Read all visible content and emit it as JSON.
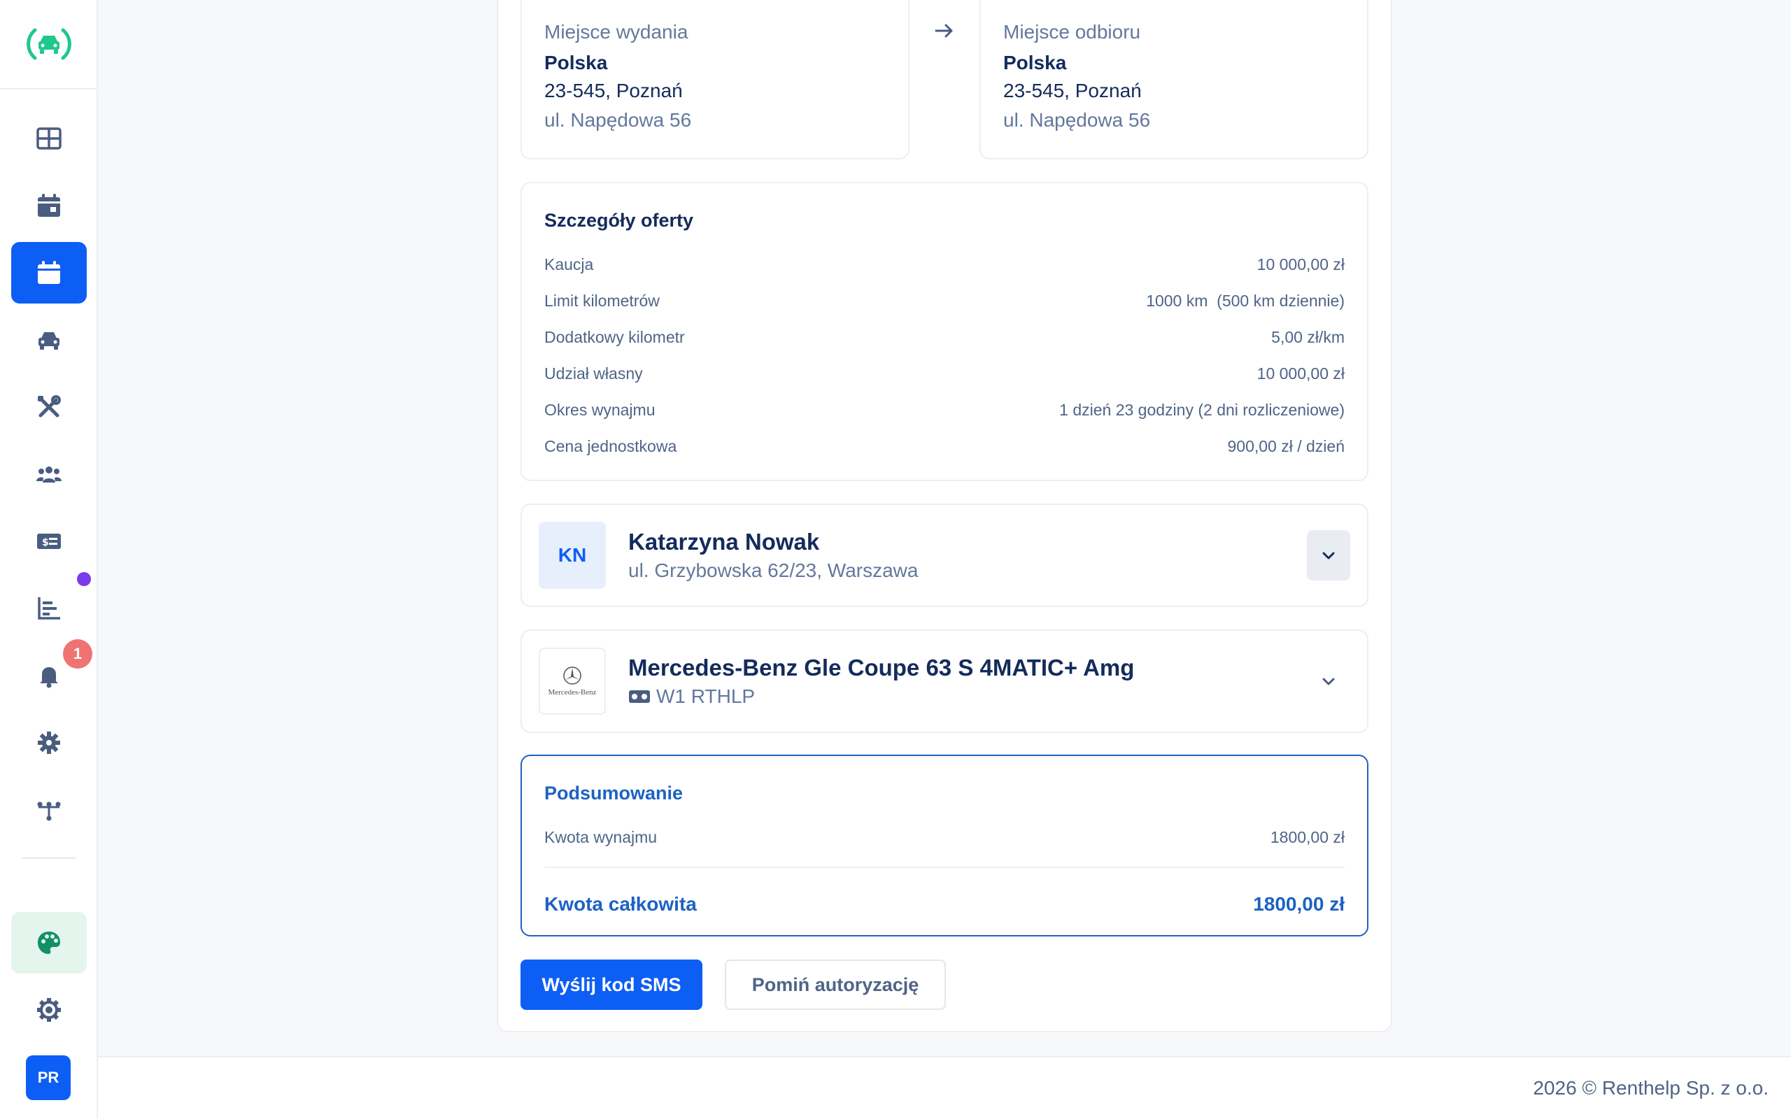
{
  "sidebar": {
    "items": [
      {
        "icon": "dashboard-grid-icon"
      },
      {
        "icon": "calendar-icon"
      },
      {
        "icon": "calendar-active-icon",
        "active": true
      },
      {
        "icon": "car-icon"
      },
      {
        "icon": "tools-icon"
      },
      {
        "icon": "users-icon"
      },
      {
        "icon": "money-card-icon"
      },
      {
        "icon": "chart-bar-icon"
      },
      {
        "icon": "bell-icon",
        "badge": "1"
      },
      {
        "icon": "gear-icon"
      },
      {
        "icon": "integrations-icon"
      }
    ],
    "user_initials": "PR"
  },
  "pickup": {
    "label": "Miejsce wydania",
    "country": "Polska",
    "city": "23-545, Poznań",
    "street": "ul. Napędowa 56"
  },
  "dropoff": {
    "label": "Miejsce odbioru",
    "country": "Polska",
    "city": "23-545, Poznań",
    "street": "ul. Napędowa 56"
  },
  "offer": {
    "title": "Szczegóły oferty",
    "rows": [
      {
        "label": "Kaucja",
        "value": "10 000,00 zł"
      },
      {
        "label": "Limit kilometrów",
        "value": "1000 km  (500 km dziennie)"
      },
      {
        "label": "Dodatkowy kilometr",
        "value": "5,00 zł/km"
      },
      {
        "label": "Udział własny",
        "value": "10 000,00 zł"
      },
      {
        "label": "Okres wynajmu",
        "value": "1 dzień 23 godziny (2 dni rozliczeniowe)"
      },
      {
        "label": "Cena jednostkowa",
        "value": "900,00 zł / dzień"
      }
    ]
  },
  "customer": {
    "initials": "KN",
    "name": "Katarzyna Nowak",
    "address": "ul. Grzybowska 62/23, Warszawa"
  },
  "vehicle": {
    "brand_logo_text": "Mercedes-Benz",
    "name": "Mercedes-Benz Gle Coupe 63 S 4MATIC+ Amg",
    "plate": "W1 RTHLP"
  },
  "summary": {
    "title": "Podsumowanie",
    "rent_label": "Kwota wynajmu",
    "rent_value": "1800,00 zł",
    "total_label": "Kwota całkowita",
    "total_value": "1800,00 zł"
  },
  "actions": {
    "send_sms": "Wyślij kod SMS",
    "skip_auth": "Pomiń autoryzację"
  },
  "footer": {
    "text": "2026 © Renthelp Sp. z o.o."
  },
  "colors": {
    "primary": "#0d5ef5",
    "logo_green": "#1ec98b",
    "summary_blue": "#1d62c4",
    "notification_badge": "#f07272",
    "status_dot": "#7c3aed"
  }
}
